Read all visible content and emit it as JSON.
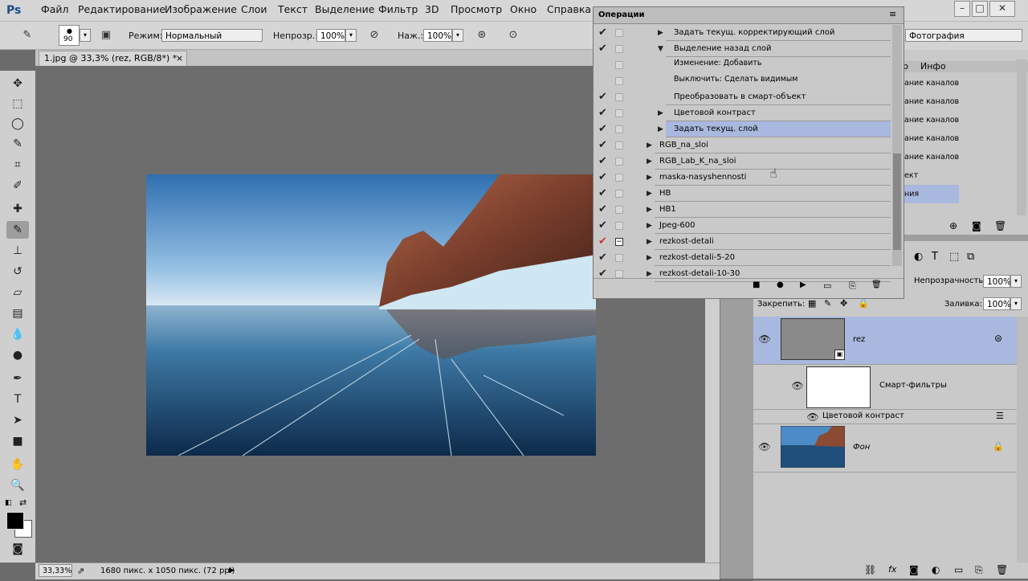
{
  "app": {
    "logo": "Ps"
  },
  "menu": [
    "Файл",
    "Редактирование",
    "Изображение",
    "Слои",
    "Текст",
    "Выделение",
    "Фильтр",
    "3D",
    "Просмотр",
    "Окно",
    "Справка"
  ],
  "window_controls": [
    "–",
    "□",
    "✕"
  ],
  "options": {
    "brush_size": "90",
    "mode_label": "Режим:",
    "mode_value": "Нормальный",
    "opacity_label": "Непрозр.:",
    "opacity_value": "100%",
    "pressure_label": "Наж.:",
    "pressure_value": "100%",
    "workspace": "Фотография"
  },
  "document": {
    "tab_title": "1.jpg @ 33,3% (rez, RGB/8*) *",
    "tab_close": "×",
    "zoom": "33,33%",
    "info": "1680 пикс. x 1050 пикс. (72 ppi)"
  },
  "actions_panel": {
    "title": "Операции",
    "rows": [
      {
        "text": "Задать текущ. корректирующий слой",
        "indent": 2,
        "check": "✔",
        "tri": "▶",
        "selected": false
      },
      {
        "text": "Выделение назад слой",
        "indent": 2,
        "check": "✔",
        "tri": "▼",
        "selected": false
      },
      {
        "text": "Изменение:  Добавить",
        "indent": 3,
        "check": "",
        "tri": "",
        "selected": false,
        "sub": true
      },
      {
        "text": "Выключить: Сделать видимым",
        "indent": 3,
        "check": "",
        "tri": "",
        "selected": false,
        "sub": true
      },
      {
        "text": "Преобразовать в смарт-объект",
        "indent": 2,
        "check": "✔",
        "tri": "",
        "selected": false
      },
      {
        "text": "Цветовой контраст",
        "indent": 2,
        "check": "✔",
        "tri": "▶",
        "selected": false
      },
      {
        "text": "Задать текущ. слой",
        "indent": 2,
        "check": "✔",
        "tri": "▶",
        "selected": true
      },
      {
        "text": "RGB_na_sloi",
        "indent": 1,
        "check": "✔",
        "tri": "▶",
        "selected": false
      },
      {
        "text": "RGB_Lab_K_na_sloi",
        "indent": 1,
        "check": "✔",
        "tri": "▶",
        "selected": false
      },
      {
        "text": "maska-nasyshennosti",
        "indent": 1,
        "check": "✔",
        "tri": "▶",
        "selected": false
      },
      {
        "text": "HB",
        "indent": 1,
        "check": "✔",
        "tri": "▶",
        "selected": false
      },
      {
        "text": "HB1",
        "indent": 1,
        "check": "✔",
        "tri": "▶",
        "selected": false
      },
      {
        "text": "Jpeg-600",
        "indent": 1,
        "check": "✔",
        "tri": "▶",
        "selected": false
      },
      {
        "text": "rezkost-detali",
        "indent": 1,
        "check": "✔",
        "tri": "▶",
        "selected": false,
        "red": true,
        "dialog": "−"
      },
      {
        "text": "rezkost-detali-5-20",
        "indent": 1,
        "check": "✔",
        "tri": "▶",
        "selected": false
      },
      {
        "text": "rezkost-detali-10-30",
        "indent": 1,
        "check": "✔",
        "tri": "▶",
        "selected": false
      }
    ],
    "footer_icons": [
      "■",
      "●",
      "▶",
      "▭",
      "⎘",
      "🗑"
    ]
  },
  "history_panel": {
    "tabs": [
      "р",
      "Инфо"
    ],
    "items": [
      "ание каналов",
      "ание каналов",
      "ание каналов",
      "ание каналов",
      "ание каналов",
      "ект",
      "",
      "ния"
    ]
  },
  "layers_panel": {
    "opacity_label": "Непрозрачность:",
    "opacity_value": "100%",
    "lock_label": "Закрепить:",
    "fill_label": "Заливка:",
    "fill_value": "100%",
    "layers": [
      {
        "name": "rez",
        "selected": true
      },
      {
        "name": "Смарт-фильтры",
        "selected": false
      },
      {
        "name": "Цветовой контраст",
        "selected": false
      },
      {
        "name": "Фон",
        "selected": false
      }
    ],
    "footer_icons": [
      "⛓",
      "fx",
      "◙",
      "◐",
      "▭",
      "⎘",
      "🗑"
    ]
  }
}
